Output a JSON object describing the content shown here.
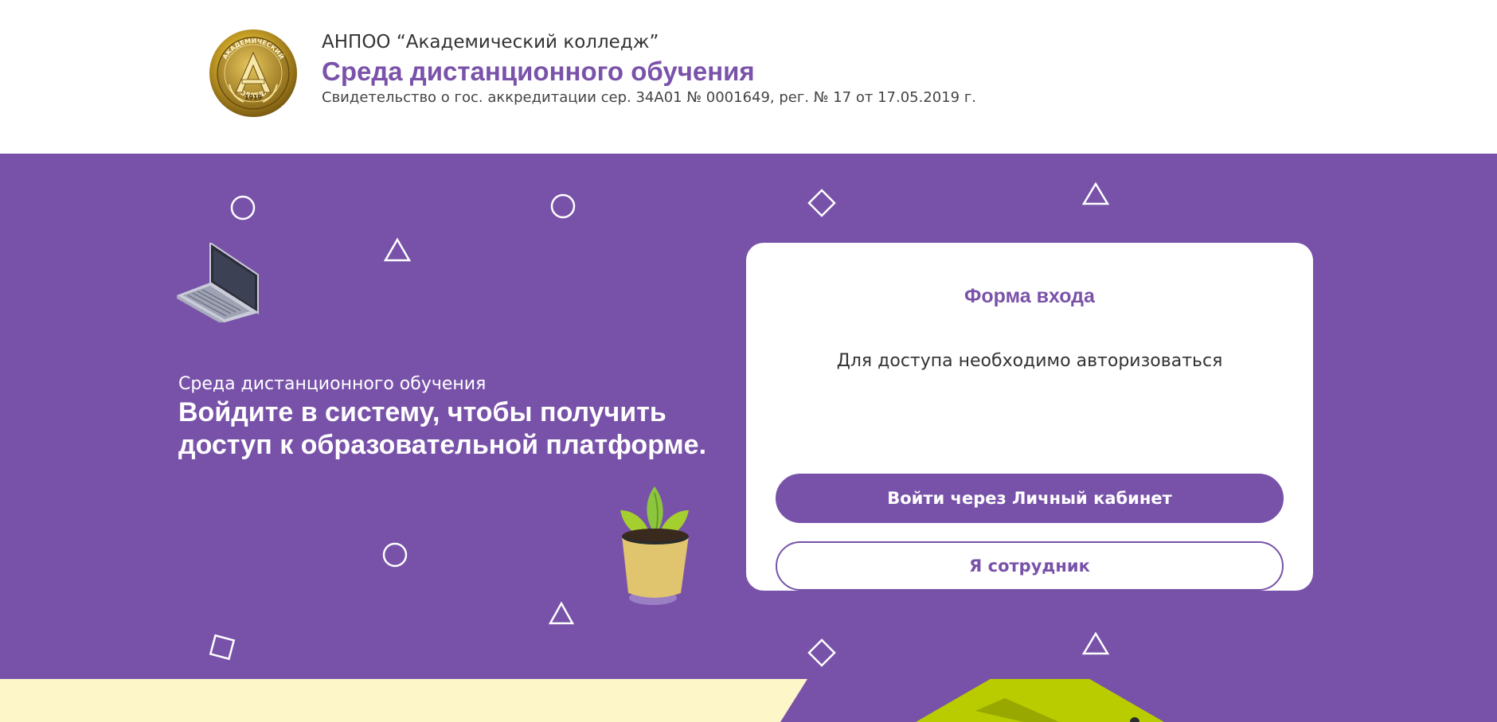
{
  "header": {
    "org_name": "АНПОО “Академический колледж”",
    "title": "Среда дистанционного обучения",
    "accreditation": "Свидетельство о гос. аккредитации сер. 34А01 № 0001649, рег. № 17 от 17.05.2019 г.",
    "logo": {
      "top_text": "АКАДЕМИЧЕСКИЙ",
      "bottom_text": "КОЛЛЕДЖ",
      "letter": "А",
      "year": "1919"
    }
  },
  "hero": {
    "subtitle": "Среда дистанционного обучения",
    "heading": "Войдите в систему, чтобы получить доступ к образовательной платформе."
  },
  "login_form": {
    "title": "Форма входа",
    "hint": "Для доступа необходимо авторизоваться",
    "primary_button": "Войти через Личный кабинет",
    "secondary_button": "Я сотрудник"
  },
  "colors": {
    "brand_purple": "#7852a9",
    "title_purple": "#7a52a9",
    "cream": "#fdf6c9",
    "lime": "#b9cc00",
    "gold": "#c9a227"
  },
  "icons": {
    "logo": "college-emblem-icon",
    "laptop": "laptop-icon",
    "plant": "potted-plant-icon",
    "circle": "circle-outline-icon",
    "triangle": "triangle-outline-icon",
    "diamond": "diamond-outline-icon",
    "square": "square-outline-icon"
  }
}
